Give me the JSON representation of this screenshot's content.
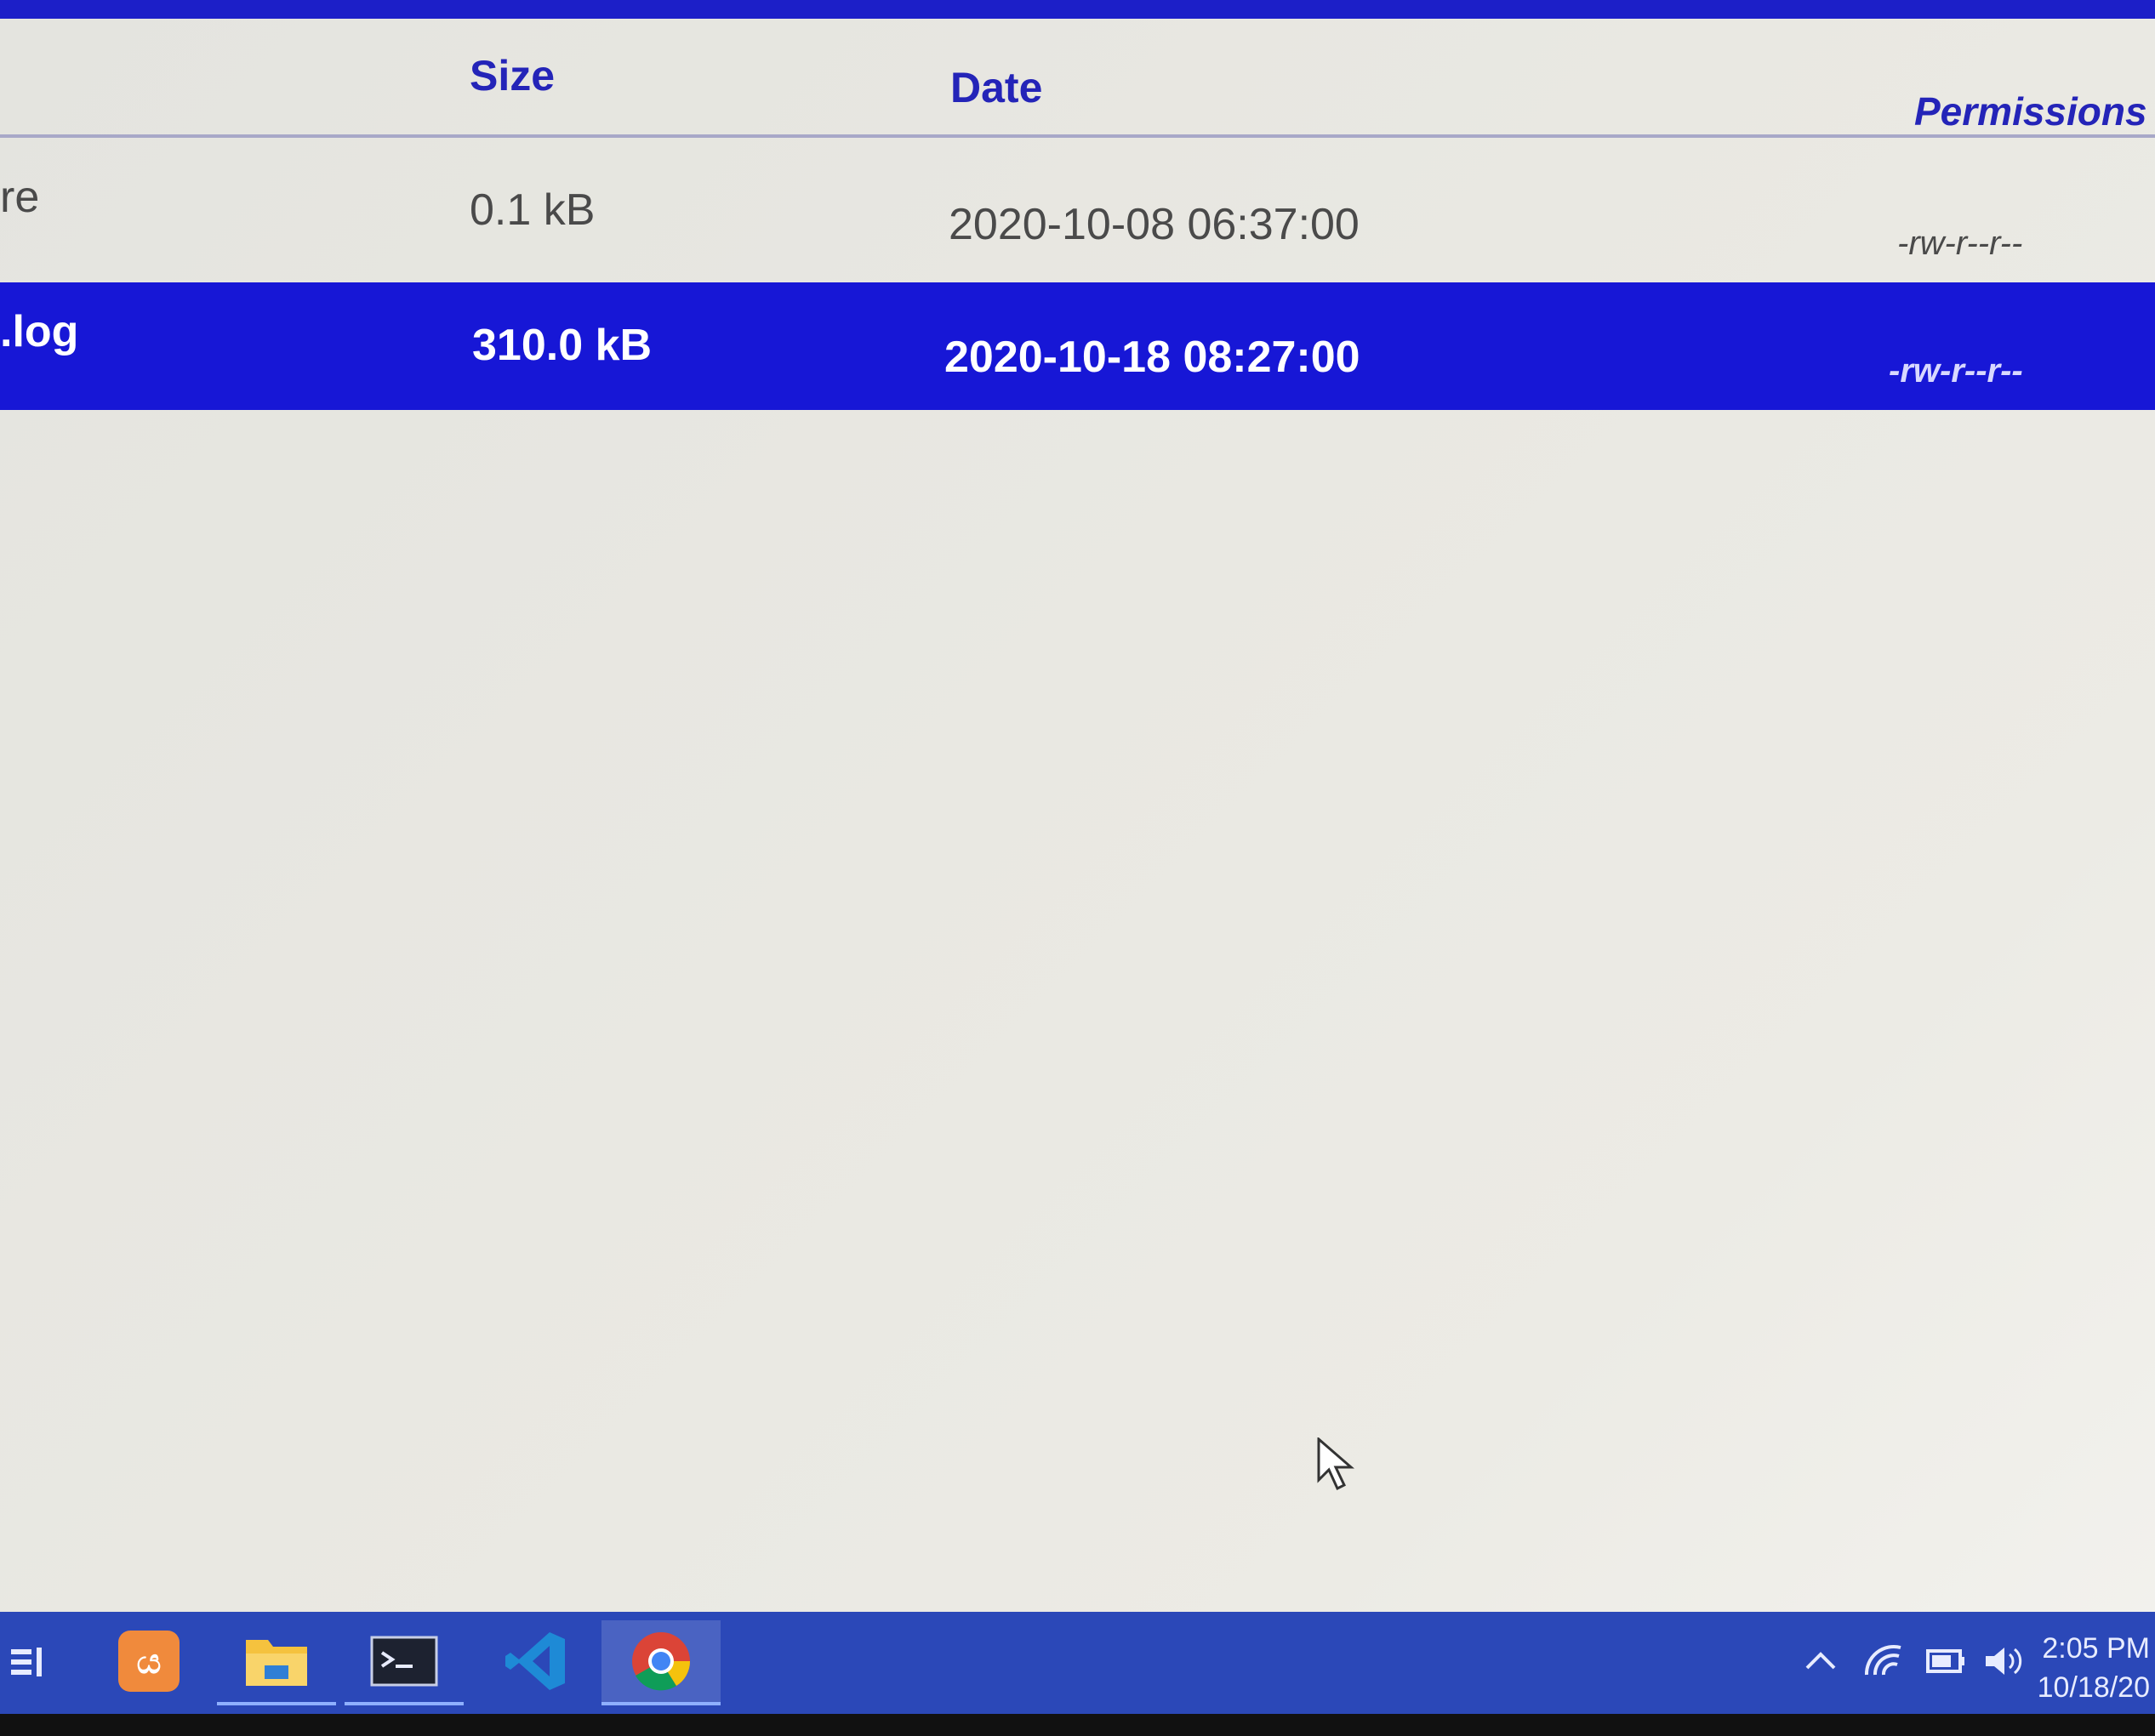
{
  "columns": {
    "size": "Size",
    "date": "Date",
    "permissions": "Permissions"
  },
  "files": [
    {
      "name": "re",
      "size": "0.1 kB",
      "date": "2020-10-08 06:37:00",
      "permissions": "-rw-r--r--",
      "selected": false
    },
    {
      "name": ".log",
      "size": "310.0 kB",
      "date": "2020-10-18 08:27:00",
      "permissions": "-rw-r--r--",
      "selected": true
    }
  ],
  "taskbar": {
    "apps": [
      "task-view-icon",
      "xampp-icon",
      "file-explorer-icon",
      "terminal-icon",
      "vscode-icon",
      "chrome-icon"
    ],
    "clock_time": "2:05 PM",
    "clock_date": "10/18/20"
  },
  "colors": {
    "accent": "#1717d6",
    "header_text": "#2424b8",
    "taskbar": "#2b48b8"
  }
}
